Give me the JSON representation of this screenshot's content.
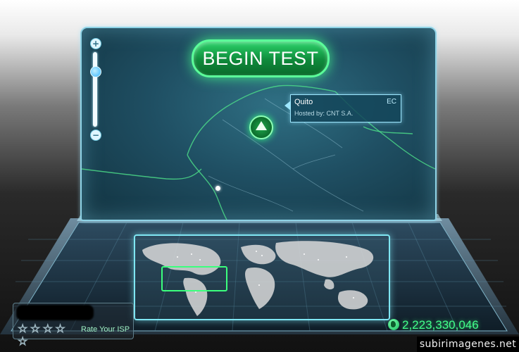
{
  "app": {
    "begin_label": "BEGIN TEST",
    "colors": {
      "accent_green": "#1fd35f",
      "screen_cyan": "#8fd3e6",
      "counter_green": "#42ff8a"
    }
  },
  "zoom": {
    "plus_label": "+",
    "minus_label": "−"
  },
  "server": {
    "city": "Quito",
    "country": "EC",
    "host": "Hosted by: CNT S.A."
  },
  "isp": {
    "rating_stars": [
      "☆",
      "☆",
      "☆",
      "☆",
      "☆"
    ],
    "rate_label": "Rate Your ISP",
    "rating_value": 0
  },
  "stats": {
    "tests_count": "2,223,330,046",
    "icon": "globe-icon"
  },
  "watermark": {
    "text": "subirimagenes.net"
  }
}
